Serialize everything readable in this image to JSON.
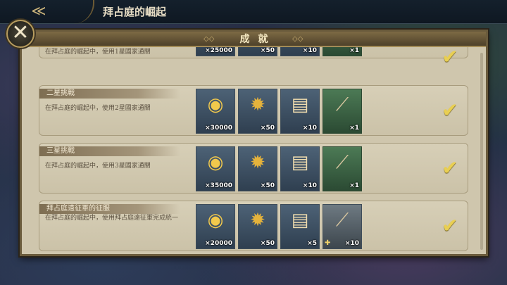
{
  "topbar": {
    "title": "拜占庭的崛起",
    "back_icon": "back-arrow-icon"
  },
  "panel": {
    "title": "成就",
    "ornament": "◇◇"
  },
  "close_icon": "close-icon",
  "achievements": [
    {
      "title": "",
      "desc": "在拜占庭的崛起中，使用1星國家通關",
      "rewards": [
        {
          "icon": "gold-coins-icon",
          "qty": "×25000"
        },
        {
          "icon": "medal-icon",
          "qty": "×50"
        },
        {
          "icon": "map-scroll-icon",
          "qty": "×10"
        },
        {
          "icon": "crossbow-icon",
          "qty": "×1"
        }
      ],
      "completed": true
    },
    {
      "title": "二星挑戰",
      "desc": "在拜占庭的崛起中，使用2星國家通關",
      "rewards": [
        {
          "icon": "gold-coins-icon",
          "qty": "×30000"
        },
        {
          "icon": "medal-icon",
          "qty": "×50"
        },
        {
          "icon": "map-scroll-icon",
          "qty": "×10"
        },
        {
          "icon": "bow-icon",
          "qty": "×1"
        }
      ],
      "completed": true
    },
    {
      "title": "三星挑戰",
      "desc": "在拜占庭的崛起中，使用3星國家通關",
      "rewards": [
        {
          "icon": "gold-coins-icon",
          "qty": "×35000"
        },
        {
          "icon": "medal-icon",
          "qty": "×50"
        },
        {
          "icon": "map-scroll-icon",
          "qty": "×10"
        },
        {
          "icon": "crossbow-icon",
          "qty": "×1"
        }
      ],
      "completed": true
    },
    {
      "title": "拜占庭遠征軍的征服",
      "desc": "在拜占庭的崛起中，使用拜占庭遠征軍完成統一",
      "rewards": [
        {
          "icon": "gold-coins-icon",
          "qty": "×20000"
        },
        {
          "icon": "medal-icon",
          "qty": "×50"
        },
        {
          "icon": "blueprint-scroll-icon",
          "qty": "×5"
        },
        {
          "icon": "warship-icon",
          "qty": "×10"
        }
      ],
      "completed": true
    }
  ],
  "glyphs": {
    "back": "≪",
    "close": "✕",
    "check": "✔",
    "coin": "◉",
    "medal": "✹",
    "scroll": "▤",
    "weapon": "⟋",
    "puzzle": "✚"
  }
}
